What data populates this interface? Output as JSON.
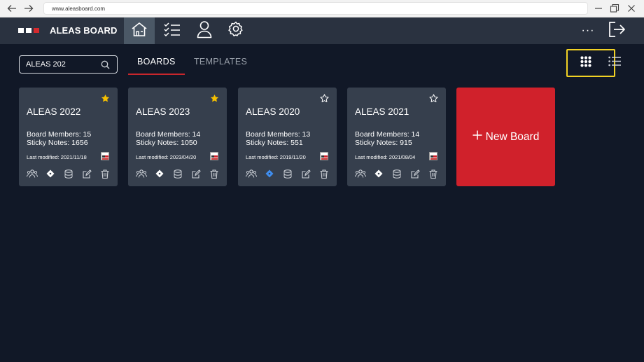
{
  "browser": {
    "url": "www.aleasboard.com"
  },
  "header": {
    "brand": "ALEAS BOARD",
    "nav": [
      "home-icon",
      "tasks-icon",
      "user-icon",
      "settings-icon"
    ],
    "more": "···"
  },
  "search": {
    "value": "ALEAS 202"
  },
  "tabs": [
    {
      "label": "BOARDS",
      "active": true
    },
    {
      "label": "TEMPLATES",
      "active": false
    }
  ],
  "boards": [
    {
      "title": "ALEAS 2022",
      "starred": true,
      "members_label": "Board Members: 15",
      "notes_label": "Sticky Notes: 1656",
      "modified_label": "Last modified: 2021/11/18",
      "diamond_color": "#ffffff"
    },
    {
      "title": "ALEAS 2023",
      "starred": true,
      "members_label": "Board Members: 14",
      "notes_label": "Sticky Notes: 1050",
      "modified_label": "Last modified: 2023/04/20",
      "diamond_color": "#ffffff"
    },
    {
      "title": "ALEAS 2020",
      "starred": false,
      "members_label": "Board Members: 13",
      "notes_label": "Sticky Notes: 551",
      "modified_label": "Last modified: 2019/11/20",
      "diamond_color": "#3f8ef0"
    },
    {
      "title": "ALEAS 2021",
      "starred": false,
      "members_label": "Board Members: 14",
      "notes_label": "Sticky Notes: 915",
      "modified_label": "Last modified: 2021/08/04",
      "diamond_color": "#ffffff"
    }
  ],
  "new_board": {
    "label": "New Board",
    "icon": "plus-icon"
  },
  "colors": {
    "accent": "#d0212b",
    "star": "#f6c000",
    "highlight": "#f2d224",
    "card": "#363f4d",
    "background": "#111827"
  }
}
